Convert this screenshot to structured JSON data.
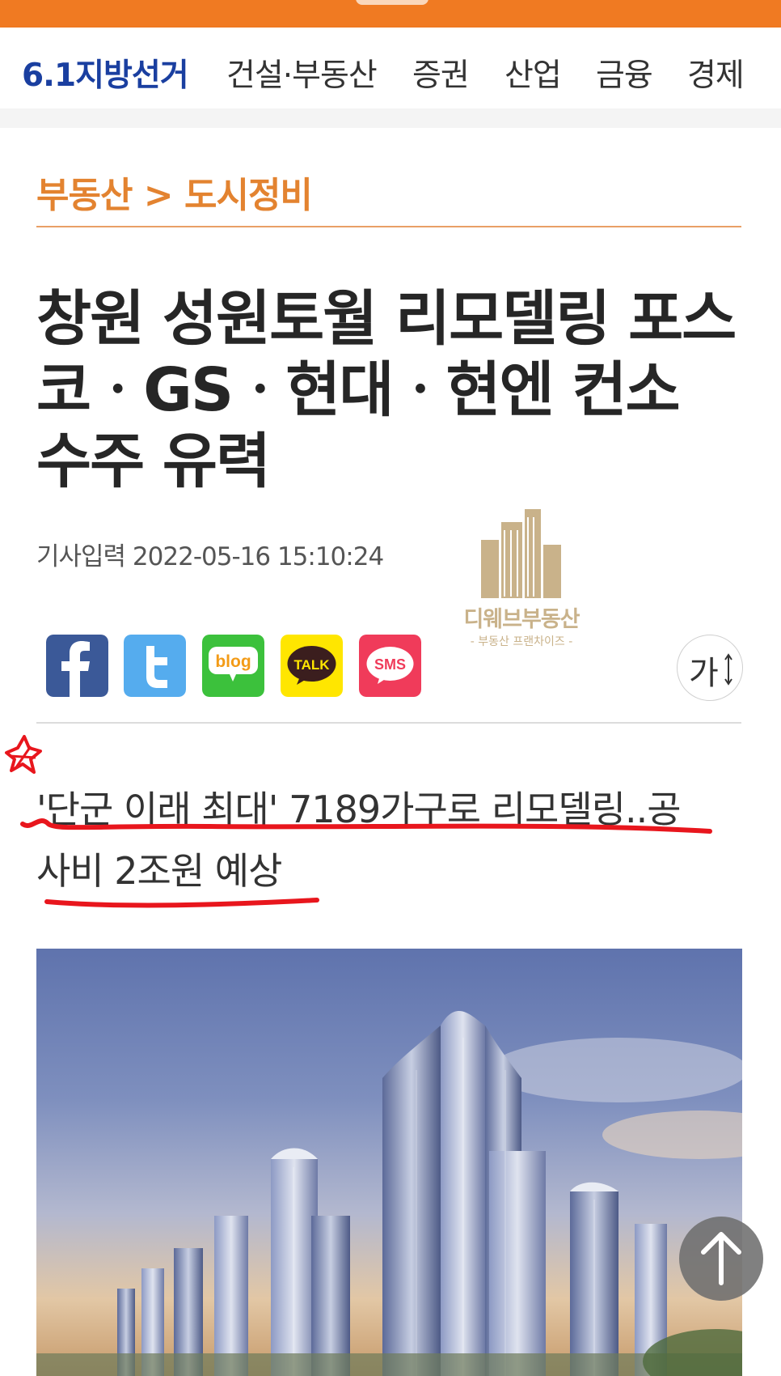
{
  "nav": {
    "items": [
      {
        "label": "6.1지방선거",
        "highlight": true
      },
      {
        "label": "건설·부동산",
        "highlight": false
      },
      {
        "label": "증권",
        "highlight": false
      },
      {
        "label": "산업",
        "highlight": false
      },
      {
        "label": "금융",
        "highlight": false
      },
      {
        "label": "경제",
        "highlight": false
      }
    ]
  },
  "breadcrumb": {
    "section": "부동산",
    "separator": ">",
    "subsection": "도시정비"
  },
  "article": {
    "title_lines": [
      "창원 성원토월 리모델링 포스",
      "코ㆍGSㆍ현대ㆍ현엔 컨소",
      "수주 유력"
    ],
    "timestamp": "기사입력 2022-05-16 15:10:24",
    "subtitle_lines": [
      "'단군 이래 최대' 7189가구로 리모델링..공",
      "사비 2조원 예상"
    ]
  },
  "watermark": {
    "name": "디웨브부동산",
    "tagline": "- 부동산 프랜차이즈 -"
  },
  "share": {
    "buttons": [
      {
        "name": "facebook",
        "color": "#3b5998"
      },
      {
        "name": "twitter",
        "color": "#55acee"
      },
      {
        "name": "blog",
        "color": "#3cc13c",
        "text": "blog"
      },
      {
        "name": "kakaotalk",
        "color": "#ffe600",
        "text": "TALK"
      },
      {
        "name": "sms",
        "color": "#f03b5a",
        "text": "SMS"
      }
    ],
    "font_size_label": "가"
  },
  "colors": {
    "header_orange": "#f07a22",
    "nav_highlight": "#1a3fa0",
    "breadcrumb": "#e38330",
    "annotation_red": "#e8161d"
  }
}
